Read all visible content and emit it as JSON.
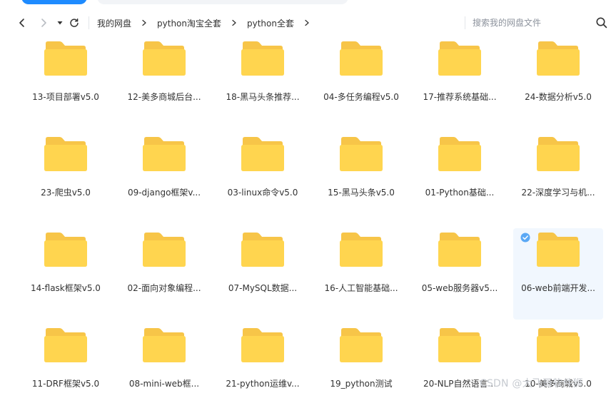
{
  "breadcrumb": {
    "items": [
      "我的网盘",
      "python淘宝全套",
      "python全套"
    ]
  },
  "search": {
    "placeholder": "搜索我的网盘文件"
  },
  "colors": {
    "folder_back": "#f7c548",
    "folder_front": "#ffd54f",
    "accent": "#1e8bff",
    "selected_bg": "#f1f7fe",
    "check": "#5aa8f5"
  },
  "icons": {
    "back": "chevron-left-icon",
    "forward": "chevron-right-icon",
    "history": "caret-down-icon",
    "refresh": "refresh-icon",
    "search": "search-icon",
    "folder": "folder-icon",
    "check": "check-circle-icon"
  },
  "folders": [
    {
      "name": "13-项目部署v5.0",
      "selected": false
    },
    {
      "name": "12-美多商城后台...",
      "selected": false
    },
    {
      "name": "18-黑马头条推荐...",
      "selected": false
    },
    {
      "name": "04-多任务编程v5.0",
      "selected": false
    },
    {
      "name": "17-推荐系统基础...",
      "selected": false
    },
    {
      "name": "24-数据分析v5.0",
      "selected": false
    },
    {
      "name": "23-爬虫v5.0",
      "selected": false
    },
    {
      "name": "09-django框架v...",
      "selected": false
    },
    {
      "name": "03-linux命令v5.0",
      "selected": false
    },
    {
      "name": "15-黑马头条v5.0",
      "selected": false
    },
    {
      "name": "01-Python基础...",
      "selected": false
    },
    {
      "name": "22-深度学习与机...",
      "selected": false
    },
    {
      "name": "14-flask框架v5.0",
      "selected": false
    },
    {
      "name": "02-面向对象编程...",
      "selected": false
    },
    {
      "name": "07-MySQL数据...",
      "selected": false
    },
    {
      "name": "16-人工智能基础...",
      "selected": false
    },
    {
      "name": "05-web服务器v5...",
      "selected": false
    },
    {
      "name": "06-web前端开发...",
      "selected": true
    },
    {
      "name": "11-DRF框架v5.0",
      "selected": false
    },
    {
      "name": "08-mini-web框...",
      "selected": false
    },
    {
      "name": "21-python运维v...",
      "selected": false
    },
    {
      "name": "19_python测试",
      "selected": false
    },
    {
      "name": "20-NLP自然语言...",
      "selected": false
    },
    {
      "name": "10-美多商城v5.0",
      "selected": false
    }
  ],
  "watermark": "CSDN @大飞哥软件狮"
}
